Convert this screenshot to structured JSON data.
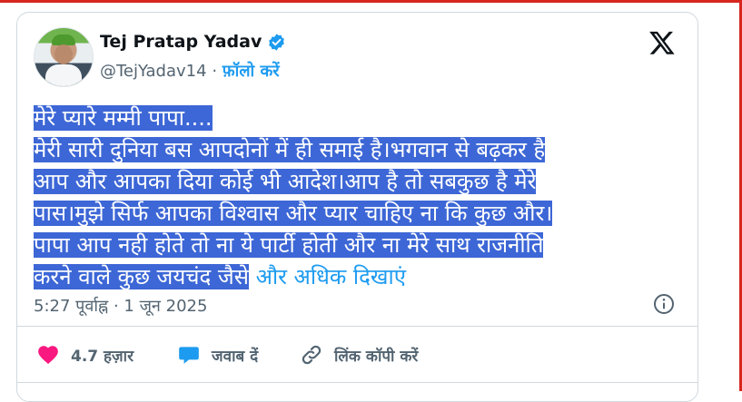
{
  "author": {
    "name": "Tej Pratap Yadav",
    "handle": "@TejYadav14",
    "separator": "·",
    "follow_label": "फ़ॉलो करें"
  },
  "post": {
    "lines": [
      "मेरे प्यारे मम्मी पापा....",
      "मेरी सारी दुनिया बस आपदोनों में ही समाई है।भगवान से बढ़कर है",
      "आप और आपका दिया कोई भी आदेश।आप है तो सबकुछ है मेरे",
      "पास।मुझे सिर्फ आपका विश्वास और प्यार चाहिए ना कि कुछ और।",
      "पापा आप नही होते तो ना ये पार्टी होती और ना मेरे साथ राजनीति",
      "करने वाले कुछ जयचंद जैसे"
    ],
    "show_more": "और अधिक दिखाएं",
    "timestamp": "5:27 पूर्वाह्न · 1 जून 2025"
  },
  "actions": {
    "likes": "4.7 हज़ार",
    "reply": "जवाब दें",
    "copy_link": "लिंक कॉपी करें"
  },
  "colors": {
    "accent": "#1d9bf0",
    "selection": "#3d67d6",
    "like": "#f91880",
    "frame": "#d7261e"
  },
  "icons": {
    "verified": "verified-badge-icon",
    "x_logo": "x-logo-icon",
    "info": "info-icon",
    "like": "heart-icon",
    "reply": "speech-bubble-icon",
    "link": "link-icon"
  }
}
